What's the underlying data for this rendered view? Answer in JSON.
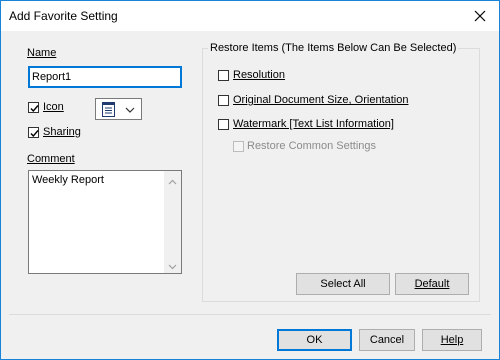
{
  "window": {
    "title": "Add Favorite Setting"
  },
  "name": {
    "label": "Name",
    "value": "Report1"
  },
  "icon": {
    "label": "Icon",
    "checked": true,
    "selected_icon": "document-icon"
  },
  "sharing": {
    "label": "Sharing",
    "checked": true
  },
  "comment": {
    "label": "Comment",
    "value": "Weekly Report"
  },
  "restore": {
    "title": "Restore Items (The Items Below Can Be Selected)",
    "items": [
      {
        "label": "Resolution",
        "checked": false,
        "enabled": true
      },
      {
        "label": "Original Document Size, Orientation",
        "checked": false,
        "enabled": true
      },
      {
        "label": "Watermark [Text List Information]",
        "checked": false,
        "enabled": true
      },
      {
        "label": "Restore Common Settings",
        "checked": false,
        "enabled": false
      }
    ],
    "select_all_label": "Select All",
    "default_label": "Default"
  },
  "footer": {
    "ok_label": "OK",
    "cancel_label": "Cancel",
    "help_label": "Help"
  },
  "colors": {
    "accent": "#0078d7",
    "title_border": "#1883d7"
  }
}
